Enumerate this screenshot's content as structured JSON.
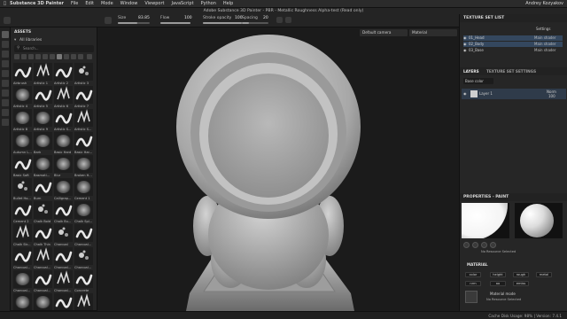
{
  "menubar": {
    "app_name": "Substance 3D Painter",
    "items": [
      "File",
      "Edit",
      "Mode",
      "Window",
      "Viewport",
      "JavaScript",
      "Python",
      "Help"
    ],
    "window_title": "Adobe Substance 3D Painter - PBR - Metallic Roughness Alpha-test (Read only)",
    "user": "Andrey Kozyakov"
  },
  "toolbar": {
    "size_label": "Size",
    "size_value": "83.85",
    "flow_label": "Flow",
    "flow_value": "100",
    "stroke_label": "Stroke opacity",
    "stroke_value": "100",
    "spacing_label": "Spacing",
    "spacing_value": "20"
  },
  "assets": {
    "title": "ASSETS",
    "library": "All libraries",
    "search_placeholder": "Search...",
    "items": [
      "Airbrush",
      "Artistic 1",
      "Artistic 2",
      "Artistic 3",
      "Artistic 4",
      "Artistic 5",
      "Artistic 6",
      "Artistic 7",
      "Artistic 8",
      "Artistic 9",
      "Artistic S...",
      "Artistic S...",
      "Autumn L...",
      "Bark",
      "Basic Hard",
      "Basic Har...",
      "Basic Soft",
      "Basmati...",
      "Blur",
      "Broken H...",
      "Bullet Ho...",
      "Burn",
      "Calligrap...",
      "Cement 1",
      "Cement 2",
      "Chalk Bold",
      "Chalk Bu...",
      "Chalk Spl...",
      "Chalk Str...",
      "Chalk Thin",
      "Charcoal",
      "Charcoal...",
      "Charcoal...",
      "Charcoal...",
      "Charcoal...",
      "Charcoal...",
      "Charcoal...",
      "Charcoal...",
      "Charcoal...",
      "Concrete",
      "Concrete...",
      "Cotton",
      "Cracks",
      "Cracks"
    ]
  },
  "viewport": {
    "camera": "Default camera",
    "channel": "Material"
  },
  "texture_sets": {
    "title": "TEXTURE SET LIST",
    "settings": "Settings",
    "rows": [
      {
        "name": "01_Head",
        "shader": "Main shader"
      },
      {
        "name": "02_Body",
        "shader": "Main shader"
      },
      {
        "name": "03_Base",
        "shader": "Main shader"
      }
    ]
  },
  "layers": {
    "tab_layers": "LAYERS",
    "tab_settings": "TEXTURE SET SETTINGS",
    "channel": "Base color",
    "layer_name": "Layer 1",
    "blend": "Norm",
    "opacity": "100"
  },
  "properties": {
    "title": "PROPERTIES - PAINT",
    "no_resource": "No Resource Selected",
    "material_header": "MATERIAL",
    "mat_buttons": [
      "color",
      "height",
      "rough",
      "metal",
      "nrm",
      "ao",
      "emiss"
    ],
    "material_mode": "Material mode",
    "no_resource_2": "No Resource Selected"
  },
  "statusbar": {
    "text": "Cache Disk Usage: 98% | Version: 7.4.1"
  },
  "colors": {
    "accent": "#34475e",
    "panel": "#262626",
    "viewport": "#1b1b1b"
  }
}
